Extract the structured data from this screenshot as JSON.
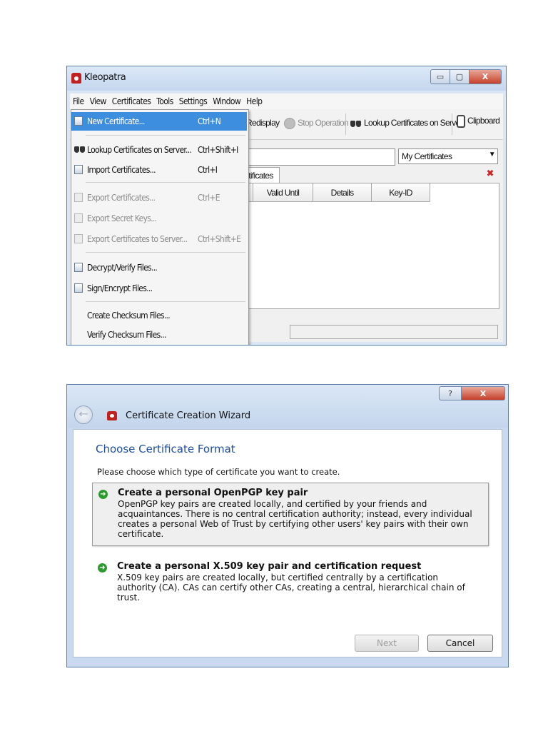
{
  "kleopatra": {
    "title": "Kleopatra",
    "window_buttons": {
      "minimize": "▭",
      "maximize": "▢",
      "close": "X"
    },
    "menubar": [
      "File",
      "View",
      "Certificates",
      "Tools",
      "Settings",
      "Window",
      "Help"
    ],
    "toolbar": {
      "redisplay": "Redisplay",
      "stop_operation": "Stop Operation",
      "lookup_server": "Lookup Certificates on Server",
      "clipboard": "Clipboard"
    },
    "filter_select": "My Certificates",
    "tab_label": "rtificates",
    "columns": [
      "Valid Until",
      "Details",
      "Key-ID"
    ],
    "file_menu": [
      {
        "label": "New Certificate...",
        "shortcut": "Ctrl+N",
        "state": "selected"
      },
      {
        "label": "Lookup Certificates on Server...",
        "shortcut": "Ctrl+Shift+I",
        "state": "enabled"
      },
      {
        "label": "Import Certificates...",
        "shortcut": "Ctrl+I",
        "state": "enabled"
      },
      {
        "label": "Export Certificates...",
        "shortcut": "Ctrl+E",
        "state": "disabled"
      },
      {
        "label": "Export Secret Keys...",
        "shortcut": "",
        "state": "disabled"
      },
      {
        "label": "Export Certificates to Server...",
        "shortcut": "Ctrl+Shift+E",
        "state": "disabled"
      },
      {
        "label": "Decrypt/Verify Files...",
        "shortcut": "",
        "state": "enabled"
      },
      {
        "label": "Sign/Encrypt Files...",
        "shortcut": "",
        "state": "enabled"
      },
      {
        "label": "Create Checksum Files...",
        "shortcut": "",
        "state": "enabled"
      },
      {
        "label": "Verify Checksum Files...",
        "shortcut": "",
        "state": "enabled"
      }
    ]
  },
  "wizard": {
    "window_buttons": {
      "help": "?",
      "close": "X"
    },
    "back_icon": "back-arrow-icon",
    "title": "Certificate Creation Wizard",
    "heading": "Choose Certificate Format",
    "instruction": "Please choose which type of certificate you want to create.",
    "options": [
      {
        "title": "Create a personal OpenPGP key pair",
        "description": "OpenPGP key pairs are created locally, and certified by your friends and acquaintances. There is no central certification authority; instead, every individual creates a personal Web of Trust by certifying other users' key pairs with their own certificate."
      },
      {
        "title": "Create a personal X.509 key pair and certification request",
        "description": "X.509 key pairs are created locally, but certified centrally by a certification authority (CA). CAs can certify other CAs, creating a central, hierarchical chain of trust."
      }
    ],
    "buttons": {
      "next": "Next",
      "cancel": "Cancel"
    }
  },
  "colors": {
    "menu_highlight": "#3e8ee0",
    "wizard_heading": "#1e4d9e",
    "option_arrow": "#2d9a2d",
    "close_button": "#c7402a"
  }
}
